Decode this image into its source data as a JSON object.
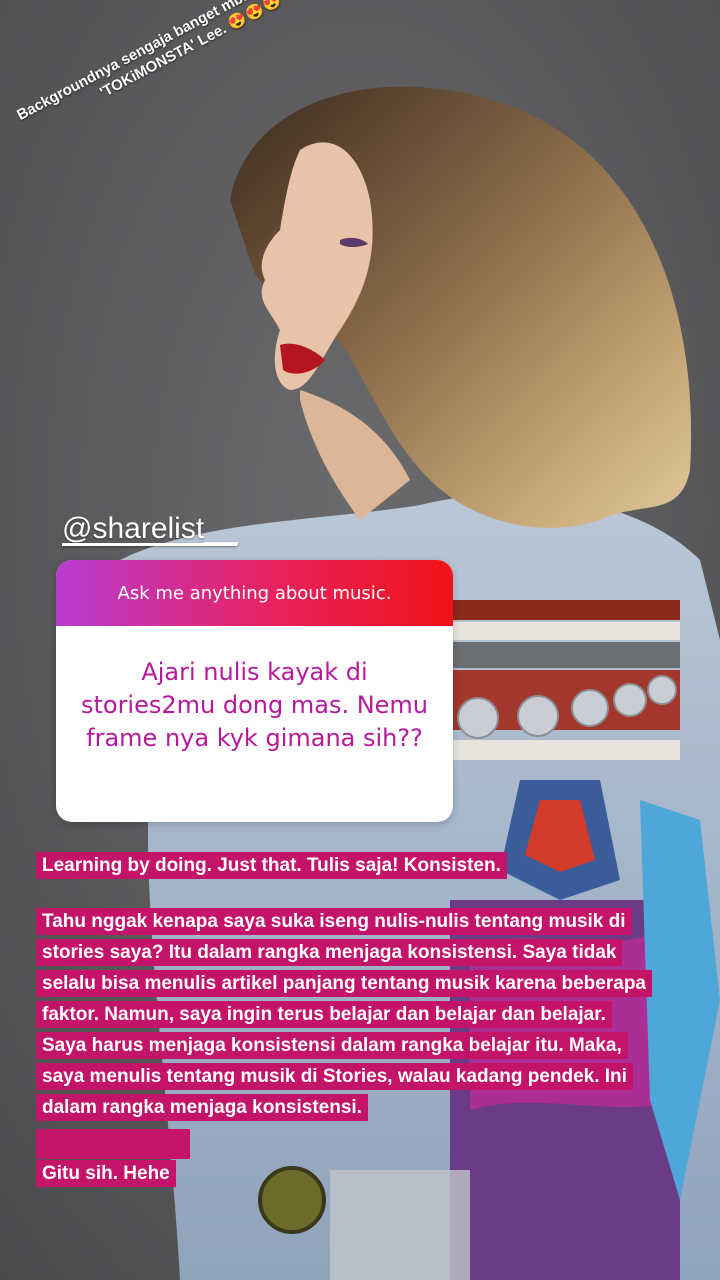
{
  "story": {
    "caption": "Backgroundnya sengaja banget mbak idola Jennifer 'TOKiMONSTA' Lee.",
    "caption_emojis": "😍😍😍",
    "mention": "@sharelist__"
  },
  "question_box": {
    "prompt": "Ask me anything about music.",
    "answer": "Ajari nulis kayak di stories2mu dong mas. Nemu frame nya kyk gimana sih??"
  },
  "response": {
    "line1": "Learning by doing. Just that. Tulis saja! Konsisten.",
    "paragraph": "Tahu nggak kenapa saya suka iseng nulis-nulis tentang musik di stories saya? Itu dalam rangka menjaga konsistensi. Saya tidak selalu bisa menulis artikel panjang tentang musik karena beberapa faktor. Namun, saya ingin terus belajar dan belajar dan belajar. Saya harus menjaga konsistensi dalam rangka belajar itu. Maka, saya menulis tentang musik di Stories, walau kadang pendek. Ini dalam rangka menjaga konsistensi.",
    "closing": "Gitu sih. Hehe"
  },
  "colors": {
    "highlight": "#c4146a",
    "answer_text": "#b6199c",
    "background": "#5a5a5d"
  }
}
